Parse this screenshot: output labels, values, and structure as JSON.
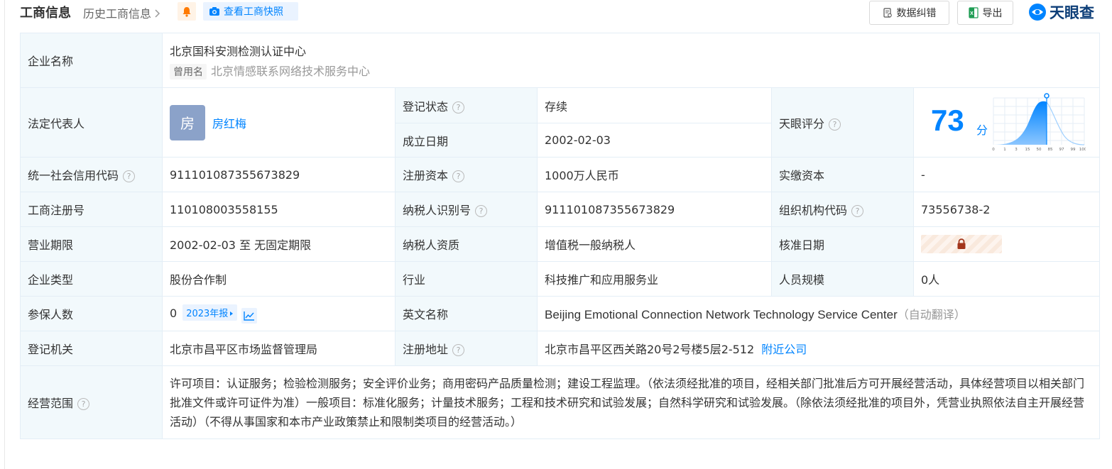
{
  "header": {
    "title": "工商信息",
    "history": "历史工商信息",
    "snapshot": "查看工商快照",
    "correct": "数据纠错",
    "export": "导出",
    "logo": "天眼查"
  },
  "labels": {
    "company_name": "企业名称",
    "legal_rep": "法定代表人",
    "reg_status": "登记状态",
    "found_date": "成立日期",
    "tianyan_score": "天眼评分",
    "credit_code": "统一社会信用代码",
    "reg_capital": "注册资本",
    "paid_capital": "实缴资本",
    "reg_number": "工商注册号",
    "taxpayer_id": "纳税人识别号",
    "org_code": "组织机构代码",
    "business_term": "营业期限",
    "taxpayer_quality": "纳税人资质",
    "approval_date": "核准日期",
    "company_type": "企业类型",
    "industry": "行业",
    "staff_size": "人员规模",
    "insured_count": "参保人数",
    "english_name": "英文名称",
    "reg_authority": "登记机关",
    "reg_address": "注册地址",
    "business_scope": "经营范围"
  },
  "values": {
    "company_name": "北京国科安测检测认证中心",
    "former_tag": "曾用名",
    "former_name": "北京情感联系网络技术服务中心",
    "avatar_char": "房",
    "legal_rep": "房红梅",
    "reg_status": "存续",
    "found_date": "2002-02-03",
    "score": "73",
    "score_unit": "分",
    "credit_code": "911101087355673829",
    "reg_capital": "1000万人民币",
    "paid_capital": "-",
    "reg_number": "110108003558155",
    "taxpayer_id": "911101087355673829",
    "org_code": "73556738-2",
    "business_term": "2002-02-03 至 无固定期限",
    "taxpayer_quality": "增值税一般纳税人",
    "company_type": "股份合作制",
    "industry": "科技推广和应用服务业",
    "staff_size": "0人",
    "insured_count": "0",
    "report_year": "2023年报",
    "english_name": "Beijing Emotional Connection Network Technology Service Center",
    "auto_translate": "（自动翻译）",
    "reg_authority": "北京市昌平区市场监督管理局",
    "reg_address": "北京市昌平区西关路20号2号楼5层2-512",
    "nearby": "附近公司",
    "business_scope": "许可项目：认证服务；检验检测服务；安全评价业务；商用密码产品质量检测；建设工程监理。（依法须经批准的项目，经相关部门批准后方可开展经营活动，具体经营项目以相关部门批准文件或许可证件为准）一般项目：标准化服务；计量技术服务；工程和技术研究和试验发展；自然科学研究和试验发展。（除依法须经批准的项目外，凭营业执照依法自主开展经营活动）（不得从事国家和本市产业政策禁止和限制类项目的经营活动。）"
  },
  "score_chart": {
    "x_ticks": [
      "0",
      "1",
      "3",
      "15",
      "50",
      "85",
      "97",
      "99",
      "100"
    ]
  },
  "colors": {
    "accent": "#0084ff",
    "status_green": "#00a22a",
    "label_bg": "#f2f9fc",
    "border": "#e4eef6"
  }
}
